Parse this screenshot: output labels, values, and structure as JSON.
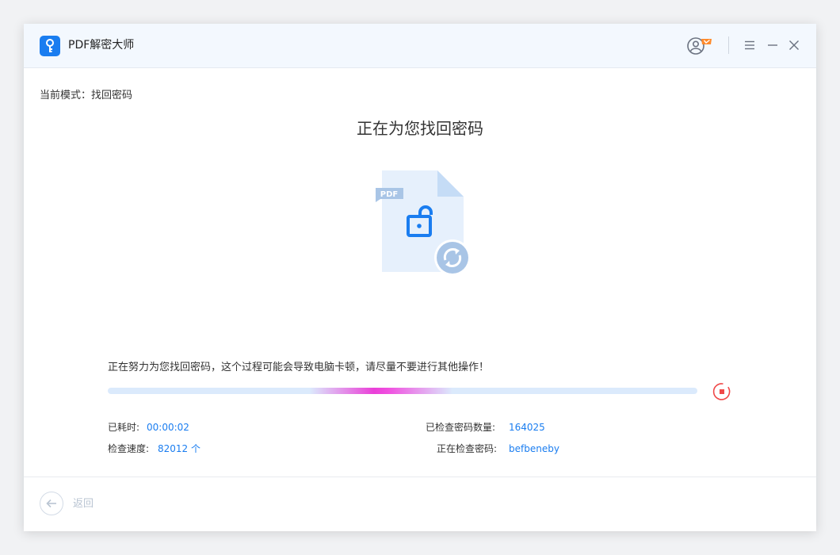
{
  "app": {
    "title": "PDF解密大师",
    "logo_icon": "key-icon",
    "accent": "#1a7df0",
    "vip_badge_color": "#ff8a2b"
  },
  "titlebar": {
    "controls": [
      "user-vip-icon",
      "menu-icon",
      "minimize-icon",
      "close-icon"
    ]
  },
  "mode": {
    "label": "当前模式：找回密码"
  },
  "main": {
    "title": "正在为您找回密码",
    "illustration": {
      "file_label": "PDF",
      "icons": [
        "pdf-document-icon",
        "unlocked-padlock-icon",
        "refresh-icon"
      ]
    },
    "status_message": "正在努力为您找回密码，这个过程可能会导致电脑卡顿，请尽量不要进行其他操作！",
    "progress": {
      "state": "indeterminate",
      "track_color": "#dbeafc",
      "shine_color": "#ea3fd8"
    },
    "stop_icon": "stop-icon",
    "stop_color": "#f04848"
  },
  "stats": {
    "elapsed_label": "已耗时:",
    "elapsed_value": "00:00:02",
    "speed_label": "检查速度:",
    "speed_value": "82012 个",
    "checked_label": "已检查密码数量:",
    "checked_value": "164025",
    "current_label": "正在检查密码:",
    "current_value": "befbeneby"
  },
  "footer": {
    "back_label": "返回",
    "back_icon": "arrow-left-icon"
  }
}
